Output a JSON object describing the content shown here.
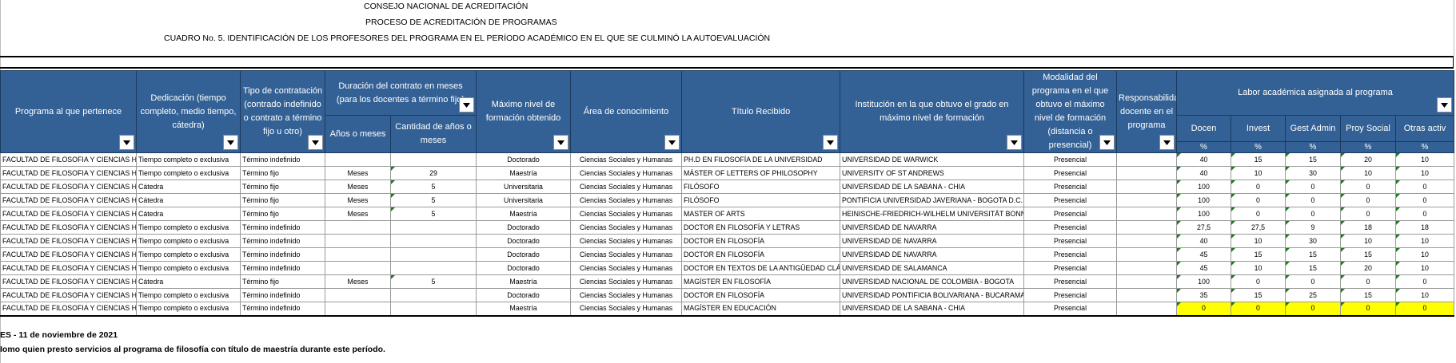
{
  "titles": {
    "line1": "CONSEJO NACIONAL DE ACREDITACIÓN",
    "line2": "PROCESO DE ACREDITACIÓN DE PROGRAMAS",
    "line3": "CUADRO No. 5. IDENTIFICACIÓN DE LOS PROFESORES DEL PROGRAMA EN EL PERÍODO ACADÉMICO EN EL QUE SE CULMINÓ LA AUTOEVALUACIÓN"
  },
  "headers": {
    "programa": "Programa al que pertenece",
    "dedicacion": "Dedicación (tiempo completo, medio tiempo, cátedra)",
    "tipo": "Tipo de contratación (contrado indefinido o contrato a término fijo u otro)",
    "duracion": "Duración del contrato en meses (para los docentes a término fijo)",
    "anos_meses": "Años o meses",
    "cantidad": "Cantidad de años o meses",
    "maximo": "Máximo nivel de formación obtenido",
    "area": "Área de conocimiento",
    "titulo": "Título Recibido",
    "institucion": "Institución en la que obtuvo el grado en máximo nivel de formación",
    "modalidad": "Modalidad del programa en el que obtuvo el máximo nivel de formación (distancia o presencial)",
    "responsabilidad": "Responsabilidad docente en el programa",
    "labor": "Labor académica asignada al programa",
    "docen": "Docen",
    "invest": "Invest",
    "gest": "Gest Admin",
    "proy": "Proy Social",
    "otras": "Otras activ",
    "pct": "%"
  },
  "rows": [
    {
      "programa": "FACULTAD DE FILOSOFIA Y CIENCIAS HUMANAS",
      "dedicacion": "Tiempo completo o exclusiva",
      "tipo": "Término indefinido",
      "um": "",
      "cant": "",
      "nivel": "Doctorado",
      "area": "Ciencias Sociales y Humanas",
      "titulo": "PH.D EN FILOSOFÍA DE LA UNIVERSIDAD",
      "inst": "UNIVERSIDAD DE WARWICK",
      "modalidad": "Presencial",
      "docen": "40",
      "invest": "15",
      "gest": "15",
      "proy": "20",
      "otras": "10"
    },
    {
      "programa": "FACULTAD DE FILOSOFIA Y CIENCIAS HUMANAS",
      "dedicacion": "Tiempo completo o exclusiva",
      "tipo": "Término fijo",
      "um": "Meses",
      "cant": "29",
      "nivel": "Maestría",
      "area": "Ciencias Sociales y Humanas",
      "titulo": "MÁSTER OF LETTERS OF PHILOSOPHY",
      "inst": "UNIVERSITY OF ST ANDREWS",
      "modalidad": "Presencial",
      "docen": "40",
      "invest": "10",
      "gest": "30",
      "proy": "10",
      "otras": "10"
    },
    {
      "programa": "FACULTAD DE FILOSOFIA Y CIENCIAS HUMANAS",
      "dedicacion": "Cátedra",
      "tipo": "Término fijo",
      "um": "Meses",
      "cant": "5",
      "nivel": "Universitaria",
      "area": "Ciencias Sociales y Humanas",
      "titulo": "FILÓSOFO",
      "inst": "UNIVERSIDAD DE LA SABANA - CHIA",
      "modalidad": "Presencial",
      "docen": "100",
      "invest": "0",
      "gest": "0",
      "proy": "0",
      "otras": "0"
    },
    {
      "programa": "FACULTAD DE FILOSOFIA Y CIENCIAS HUMANAS",
      "dedicacion": "Cátedra",
      "tipo": "Término fijo",
      "um": "Meses",
      "cant": "5",
      "nivel": "Universitaria",
      "area": "Ciencias Sociales y Humanas",
      "titulo": "FILÓSOFO",
      "inst": "PONTIFICIA UNIVERSIDAD JAVERIANA - BOGOTA D.C.",
      "modalidad": "Presencial",
      "docen": "100",
      "invest": "0",
      "gest": "0",
      "proy": "0",
      "otras": "0"
    },
    {
      "programa": "FACULTAD DE FILOSOFIA Y CIENCIAS HUMANAS",
      "dedicacion": "Cátedra",
      "tipo": "Término fijo",
      "um": "Meses",
      "cant": "5",
      "nivel": "Maestría",
      "area": "Ciencias Sociales y Humanas",
      "titulo": "MASTER OF ARTS",
      "inst": "HEINISCHE-FRIEDRICH-WILHELM UNIVERSITÄT BONN",
      "modalidad": "Presencial",
      "docen": "100",
      "invest": "0",
      "gest": "0",
      "proy": "0",
      "otras": "0"
    },
    {
      "programa": "FACULTAD DE FILOSOFIA Y CIENCIAS HUMANAS",
      "dedicacion": "Tiempo completo o exclusiva",
      "tipo": "Término indefinido",
      "um": "",
      "cant": "",
      "nivel": "Doctorado",
      "area": "Ciencias Sociales y Humanas",
      "titulo": "DOCTOR EN FILOSOFÍA Y LETRAS",
      "inst": "UNIVERSIDAD DE NAVARRA",
      "modalidad": "Presencial",
      "docen": "27,5",
      "invest": "27,5",
      "gest": "9",
      "proy": "18",
      "otras": "18"
    },
    {
      "programa": "FACULTAD DE FILOSOFIA Y CIENCIAS HUMANAS",
      "dedicacion": "Tiempo completo o exclusiva",
      "tipo": "Término indefinido",
      "um": "",
      "cant": "",
      "nivel": "Doctorado",
      "area": "Ciencias Sociales y Humanas",
      "titulo": "DOCTOR EN FILOSOFÍA",
      "inst": "UNIVERSIDAD DE NAVARRA",
      "modalidad": "Presencial",
      "docen": "40",
      "invest": "10",
      "gest": "30",
      "proy": "10",
      "otras": "10"
    },
    {
      "programa": "FACULTAD DE FILOSOFIA Y CIENCIAS HUMANAS",
      "dedicacion": "Tiempo completo o exclusiva",
      "tipo": "Término indefinido",
      "um": "",
      "cant": "",
      "nivel": "Doctorado",
      "area": "Ciencias Sociales y Humanas",
      "titulo": "DOCTOR EN FILOSOFÍA",
      "inst": "UNIVERSIDAD DE NAVARRA",
      "modalidad": "Presencial",
      "docen": "45",
      "invest": "15",
      "gest": "15",
      "proy": "15",
      "otras": "10"
    },
    {
      "programa": "FACULTAD DE FILOSOFIA Y CIENCIAS HUMANAS",
      "dedicacion": "Tiempo completo o exclusiva",
      "tipo": "Término indefinido",
      "um": "",
      "cant": "",
      "nivel": "Doctorado",
      "area": "Ciencias Sociales y Humanas",
      "titulo": "DOCTOR EN TEXTOS DE LA ANTIGÜEDAD CLÁSICA",
      "inst": "UNIVERSIDAD DE SALAMANCA",
      "modalidad": "Presencial",
      "docen": "45",
      "invest": "10",
      "gest": "15",
      "proy": "20",
      "otras": "10"
    },
    {
      "programa": "FACULTAD DE FILOSOFIA Y CIENCIAS HUMANAS",
      "dedicacion": "Cátedra",
      "tipo": "Término fijo",
      "um": "Meses",
      "cant": "5",
      "nivel": "Maestría",
      "area": "Ciencias Sociales y Humanas",
      "titulo": "MAGÍSTER EN FILOSOFÍA",
      "inst": "UNIVERSIDAD NACIONAL DE COLOMBIA - BOGOTA",
      "modalidad": "Presencial",
      "docen": "100",
      "invest": "0",
      "gest": "0",
      "proy": "0",
      "otras": "0"
    },
    {
      "programa": "FACULTAD DE FILOSOFIA Y CIENCIAS HUMANAS",
      "dedicacion": "Tiempo completo o exclusiva",
      "tipo": "Término indefinido",
      "um": "",
      "cant": "",
      "nivel": "Doctorado",
      "area": "Ciencias Sociales y Humanas",
      "titulo": "DOCTOR EN FILOSOFÍA",
      "inst": "UNIVERSIDAD PONTIFICIA BOLIVARIANA - BUCARAMANGA",
      "modalidad": "Presencial",
      "docen": "35",
      "invest": "15",
      "gest": "25",
      "proy": "15",
      "otras": "10"
    },
    {
      "programa": "FACULTAD DE FILOSOFIA Y CIENCIAS HUMANAS",
      "dedicacion": "Tiempo completo o exclusiva",
      "tipo": "Término indefinido",
      "um": "",
      "cant": "",
      "nivel": "Maestría",
      "area": "Ciencias Sociales y Humanas",
      "titulo": "MAGÍSTER EN EDUCACIÓN",
      "inst": "UNIVERSIDAD DE LA SABANA - CHIA",
      "modalidad": "Presencial",
      "docen": "0",
      "invest": "0",
      "gest": "0",
      "proy": "0",
      "otras": "0"
    }
  ],
  "footer": {
    "line1": "ES -  11 de noviembre de 2021",
    "line2": "Iomo quien presto servicios al programa de filosofía con título de maestría durante este período."
  },
  "colors": {
    "header_bg": "#336195",
    "highlight": "#ffff00"
  }
}
